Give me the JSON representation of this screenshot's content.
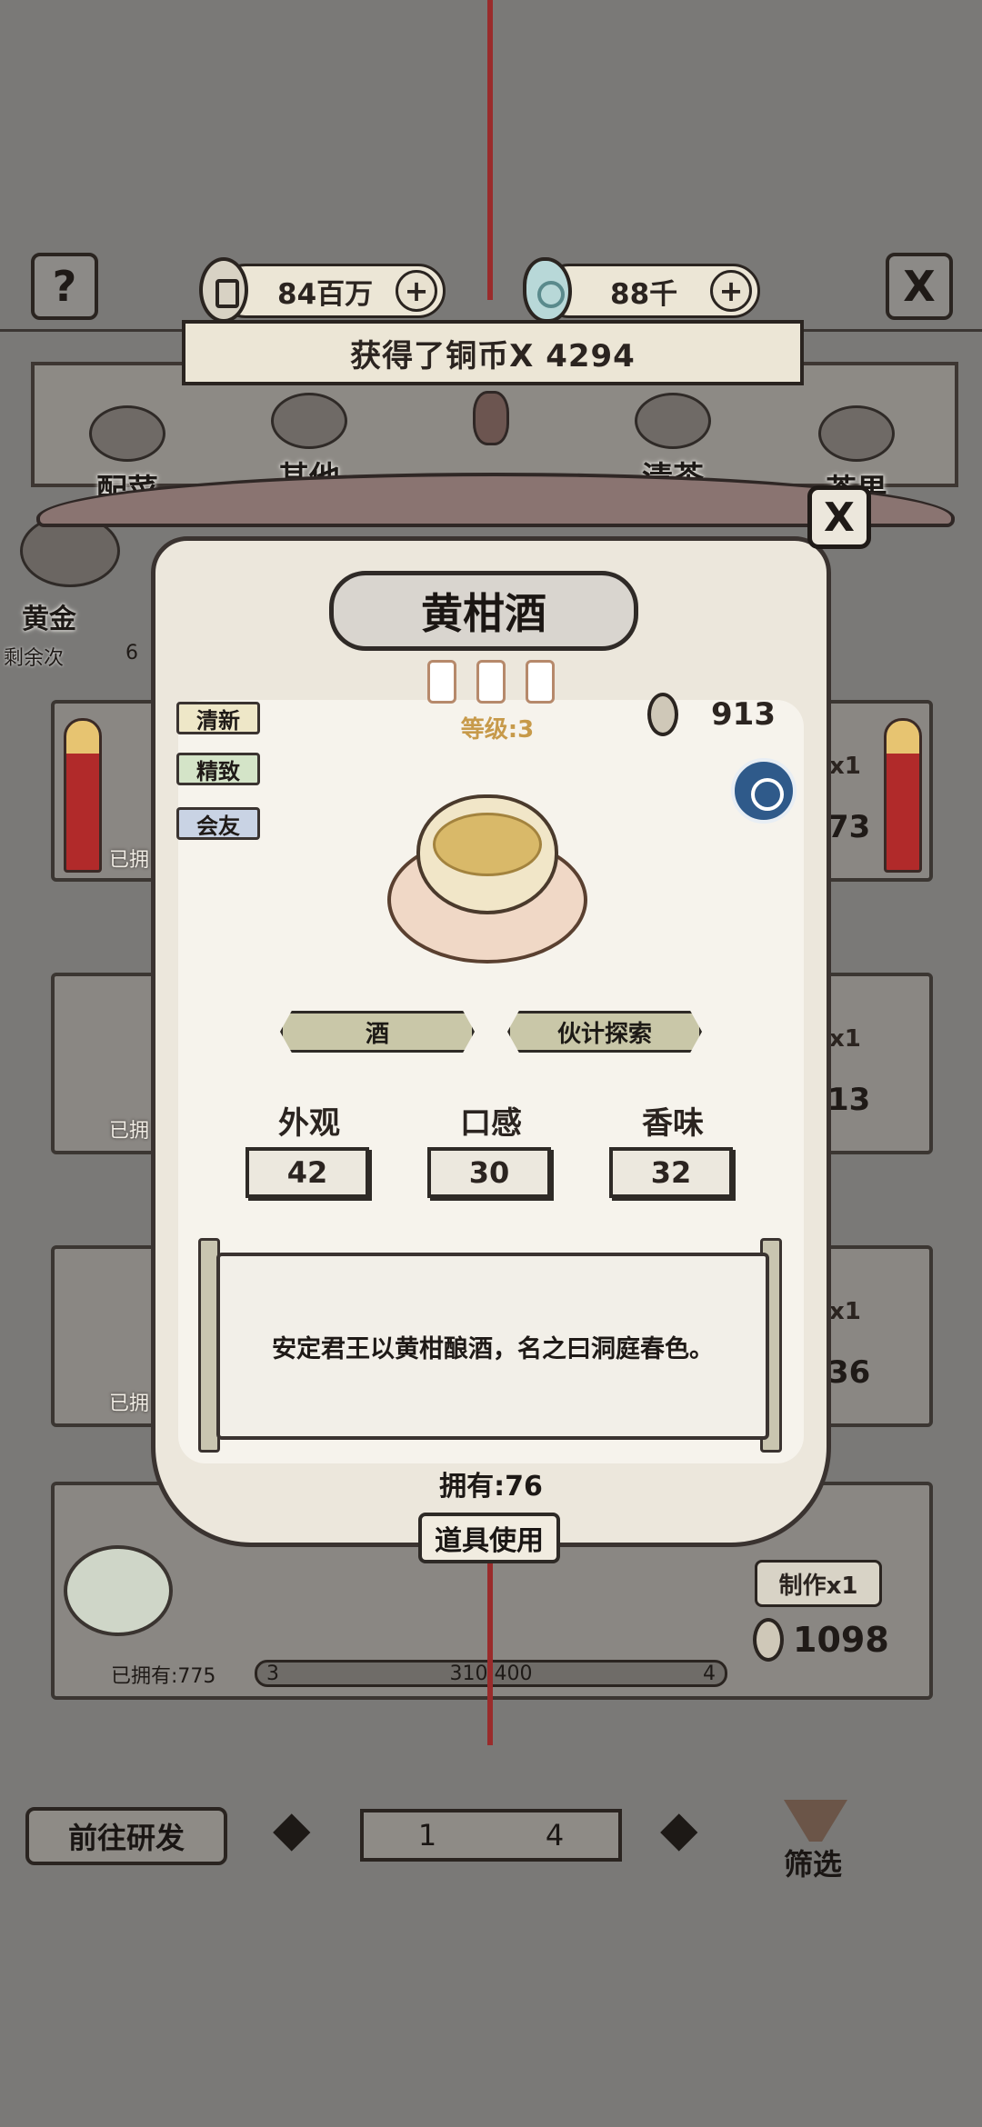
{
  "header": {
    "help_icon": "?",
    "close_icon": "X",
    "copper": {
      "value": "84百万",
      "plus": "+"
    },
    "jade": {
      "value": "88千",
      "plus": "+"
    }
  },
  "notice": "获得了铜币X 4294",
  "categories": [
    "配菜",
    "其他",
    "清茶",
    "茶果"
  ],
  "left_partial": {
    "name": "黄金",
    "remaining": "剩余次",
    "digit": "6"
  },
  "background_cards": [
    {
      "owned": "已拥",
      "right": "73",
      "badge": "x1"
    },
    {
      "owned": "已拥",
      "right": "13",
      "badge": "x1"
    },
    {
      "owned": "已拥",
      "right": "36",
      "badge": "x1"
    }
  ],
  "bottom_card": {
    "owned": "已拥有:775",
    "make": "制作x1",
    "price": "1098",
    "level_from": "3",
    "level_to": "4",
    "progress_text": "310 400",
    "progress": 0.775
  },
  "footer": {
    "goto": "前往研发",
    "page_current": "1",
    "page_total": "4",
    "filter": "筛选"
  },
  "modal": {
    "title": "黄柑酒",
    "level": "等级:3",
    "price": "913",
    "tags": [
      "清新",
      "精致",
      "会友"
    ],
    "tag_colors": [
      "#eee7c8",
      "#d4e4c8",
      "#c9d3e4"
    ],
    "buttons": [
      "酒",
      "伙计探索"
    ],
    "stats": [
      {
        "label": "外观",
        "value": "42"
      },
      {
        "label": "口感",
        "value": "30"
      },
      {
        "label": "香味",
        "value": "32"
      }
    ],
    "description": "安定君王以黄柑酿酒，名之曰洞庭春色。",
    "owned": "拥有:76",
    "use_item": "道具使用",
    "close": "X"
  }
}
